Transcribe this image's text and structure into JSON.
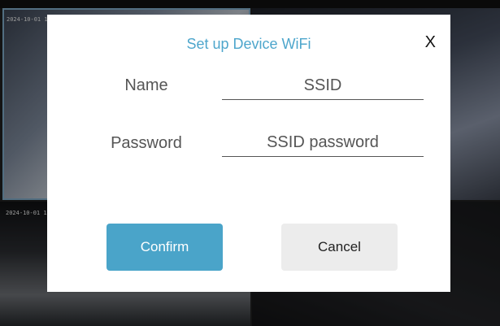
{
  "background": {
    "camera_timestamps": [
      "2024-10-01 16",
      "2024-10-01 16"
    ]
  },
  "dialog": {
    "title": "Set up Device WiFi",
    "close_label": "X",
    "name_label": "Name",
    "name_placeholder": "SSID",
    "name_value": "",
    "password_label": "Password",
    "password_placeholder": "SSID password",
    "password_value": "",
    "confirm_label": "Confirm",
    "cancel_label": "Cancel"
  },
  "colors": {
    "accent": "#4ea6cc",
    "confirm_button": "#4aa4c9",
    "cancel_button": "#ececec"
  }
}
